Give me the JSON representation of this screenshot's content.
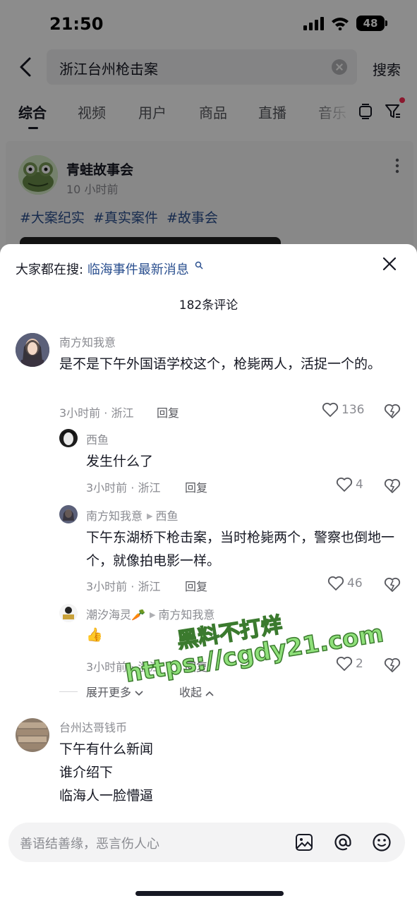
{
  "status_bar": {
    "time": "21:50",
    "battery": "48"
  },
  "search": {
    "query": "浙江台州枪击案",
    "button": "搜索"
  },
  "tabs": [
    {
      "label": "综合",
      "active": true
    },
    {
      "label": "视频",
      "active": false
    },
    {
      "label": "用户",
      "active": false
    },
    {
      "label": "商品",
      "active": false
    },
    {
      "label": "直播",
      "active": false
    },
    {
      "label": "音乐",
      "active": false
    }
  ],
  "post": {
    "author": "青蛙故事会",
    "time": "10 小时前",
    "tags": [
      "#大案纪实",
      "#真实案件",
      "#故事会"
    ]
  },
  "sheet": {
    "search_prefix": "大家都在搜:",
    "search_keyword": "临海事件最新消息",
    "comment_count": "182条评论",
    "close_icon": "close-icon"
  },
  "comments": [
    {
      "user": "南方知我意",
      "text": "是不是下午外国语学校这个，枪毙两人，活捉一个的。",
      "meta": "3小时前 · 浙江",
      "reply": "回复",
      "likes": "136"
    },
    {
      "user": "西鱼",
      "text": "发生什么了",
      "meta": "3小时前 · 浙江",
      "reply": "回复",
      "likes": "4"
    },
    {
      "user": "南方知我意",
      "reply_to": "西鱼",
      "text": "下午东湖桥下枪击案，当时枪毙两个，警察也倒地一个，就像拍电影一样。",
      "meta": "3小时前 · 浙江",
      "reply": "回复",
      "likes": "46"
    },
    {
      "user": "潮汐海灵🥕",
      "reply_to": "南方知我意",
      "text": "👍",
      "meta": "3小时前 · 浙江",
      "reply": "回复",
      "likes": "2"
    },
    {
      "user": "台州达哥钱币",
      "text_lines": [
        "下午有什么新闻",
        "谁介绍下",
        "临海人一脸懵逼"
      ]
    }
  ],
  "thread_controls": {
    "expand": "展开更多",
    "collapse": "收起"
  },
  "input": {
    "placeholder": "善语结善缘，恶言伤人心"
  },
  "watermark": {
    "line1": "黑料不打烊",
    "line2": "https://cgdy21.com"
  },
  "colors": {
    "link_blue": "#2a4f8f",
    "accent_red": "#fe2c55",
    "watermark_green": "#8fe07a"
  }
}
